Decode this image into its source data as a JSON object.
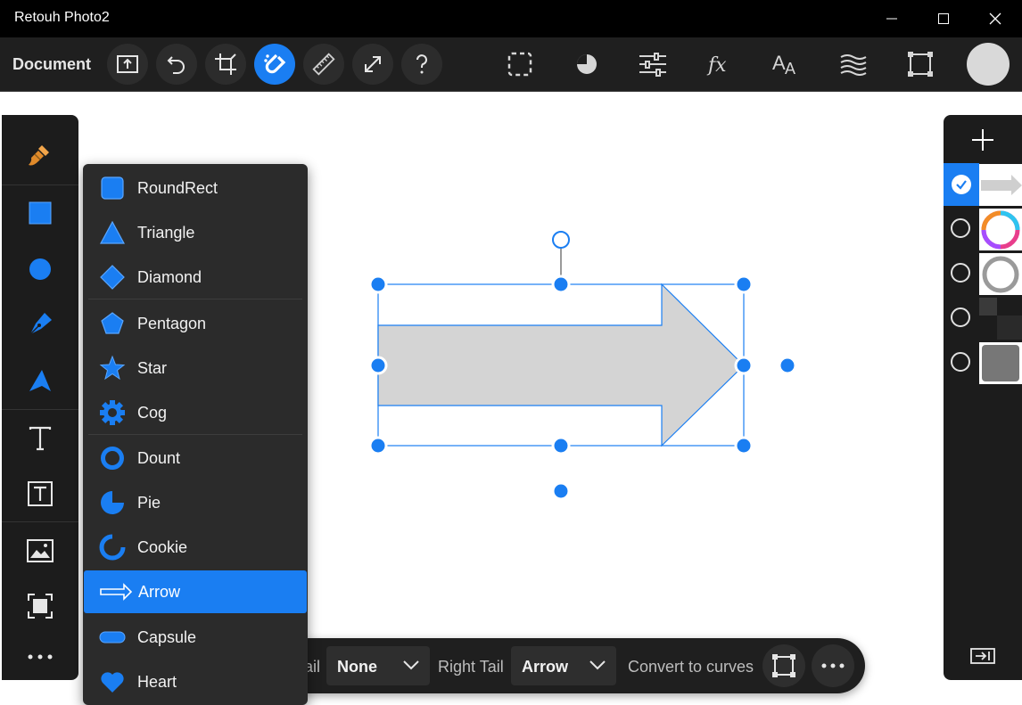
{
  "window": {
    "title": "Retouh Photo2",
    "controls": [
      "minimize-icon",
      "maximize-icon",
      "close-icon"
    ]
  },
  "toolbar": {
    "document_label": "Document",
    "left_tools": [
      "export-icon",
      "undo-icon",
      "crop-icon",
      "snap-magnet-icon",
      "ruler-icon",
      "resize-icon",
      "help-icon"
    ],
    "active_tool": "snap-magnet-icon",
    "right_tools": [
      "selection-icon",
      "pie-adjust-icon",
      "sliders-icon",
      "fx-icon",
      "text-style-icon",
      "waves-icon",
      "transform-icon"
    ],
    "accent_color": "#1a7ef2"
  },
  "left_tools": [
    "brush-icon",
    "rectangle-icon",
    "ellipse-icon",
    "pen-icon",
    "arrow-pointer-icon",
    "text-icon",
    "text-frame-icon",
    "image-icon",
    "crop-frame-icon",
    "more-icon"
  ],
  "shape_menu": {
    "items": [
      {
        "label": "RoundRect",
        "icon": "roundrect-icon"
      },
      {
        "label": "Triangle",
        "icon": "triangle-icon"
      },
      {
        "label": "Diamond",
        "icon": "diamond-icon"
      },
      {
        "label": "Pentagon",
        "icon": "pentagon-icon"
      },
      {
        "label": "Star",
        "icon": "star-icon"
      },
      {
        "label": "Cog",
        "icon": "cog-icon"
      },
      {
        "label": "Dount",
        "icon": "donut-icon"
      },
      {
        "label": "Pie",
        "icon": "pie-icon"
      },
      {
        "label": "Cookie",
        "icon": "cookie-icon"
      },
      {
        "label": "Arrow",
        "icon": "arrow-shape-icon"
      },
      {
        "label": "Capsule",
        "icon": "capsule-icon"
      },
      {
        "label": "Heart",
        "icon": "heart-icon"
      }
    ],
    "selected": "Arrow"
  },
  "bottom_bar": {
    "left_tail_label": "ail",
    "left_tail_value": "None",
    "right_tail_label": "Right Tail",
    "right_tail_value": "Arrow",
    "convert_label": "Convert to curves"
  },
  "layers": {
    "checked_index": 0,
    "thumbnails": [
      "arrow-thumb",
      "color-ring-thumb",
      "gray-ring-thumb",
      "dark-thumb",
      "gray-rect-thumb"
    ]
  }
}
